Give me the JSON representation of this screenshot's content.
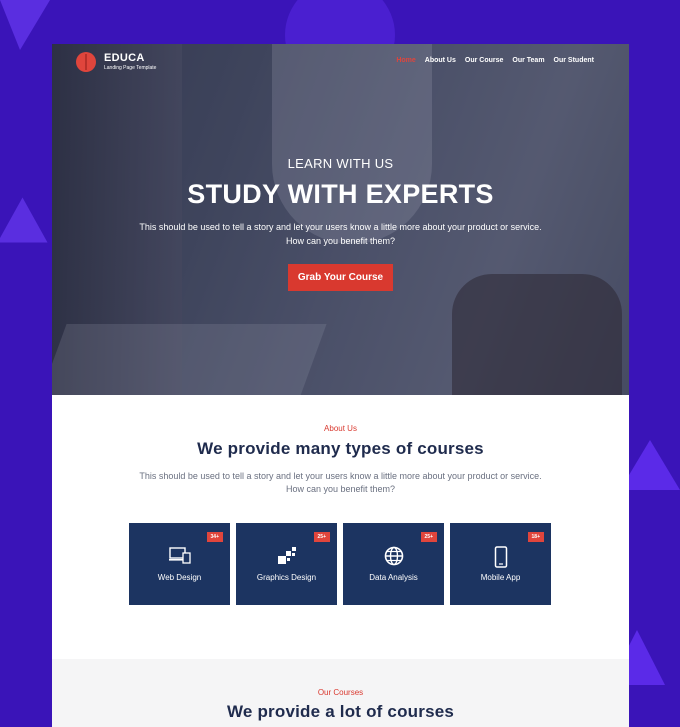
{
  "brand": {
    "name": "EDUCA",
    "tagline": "Landing Page Template",
    "accent": "#d9392f",
    "navy": "#1c3461",
    "background": "#3a14b8"
  },
  "nav": {
    "items": [
      {
        "label": "Home",
        "active": true
      },
      {
        "label": "About Us"
      },
      {
        "label": "Our Course"
      },
      {
        "label": "Our Team"
      },
      {
        "label": "Our Student"
      }
    ]
  },
  "hero": {
    "kicker": "LEARN WITH US",
    "title": "STUDY WITH EXPERTS",
    "description": "This should be used to tell a story and let your users know a little more about your product or service. How can you benefit them?",
    "cta": "Grab Your Course"
  },
  "about": {
    "kicker": "About Us",
    "title": "We provide many types of courses",
    "description": "This should be used to tell a story and let your users know a little more about your product or service. How can you benefit them?",
    "cards": [
      {
        "label": "Web Design",
        "badge": "34+",
        "icon": "devices-icon"
      },
      {
        "label": "Graphics Design",
        "badge": "25+",
        "icon": "graphics-icon"
      },
      {
        "label": "Data Analysis",
        "badge": "25+",
        "icon": "globe-icon"
      },
      {
        "label": "Mobile App",
        "badge": "18+",
        "icon": "mobile-icon"
      }
    ]
  },
  "courses": {
    "kicker": "Our Courses",
    "title": "We provide a lot of courses"
  }
}
